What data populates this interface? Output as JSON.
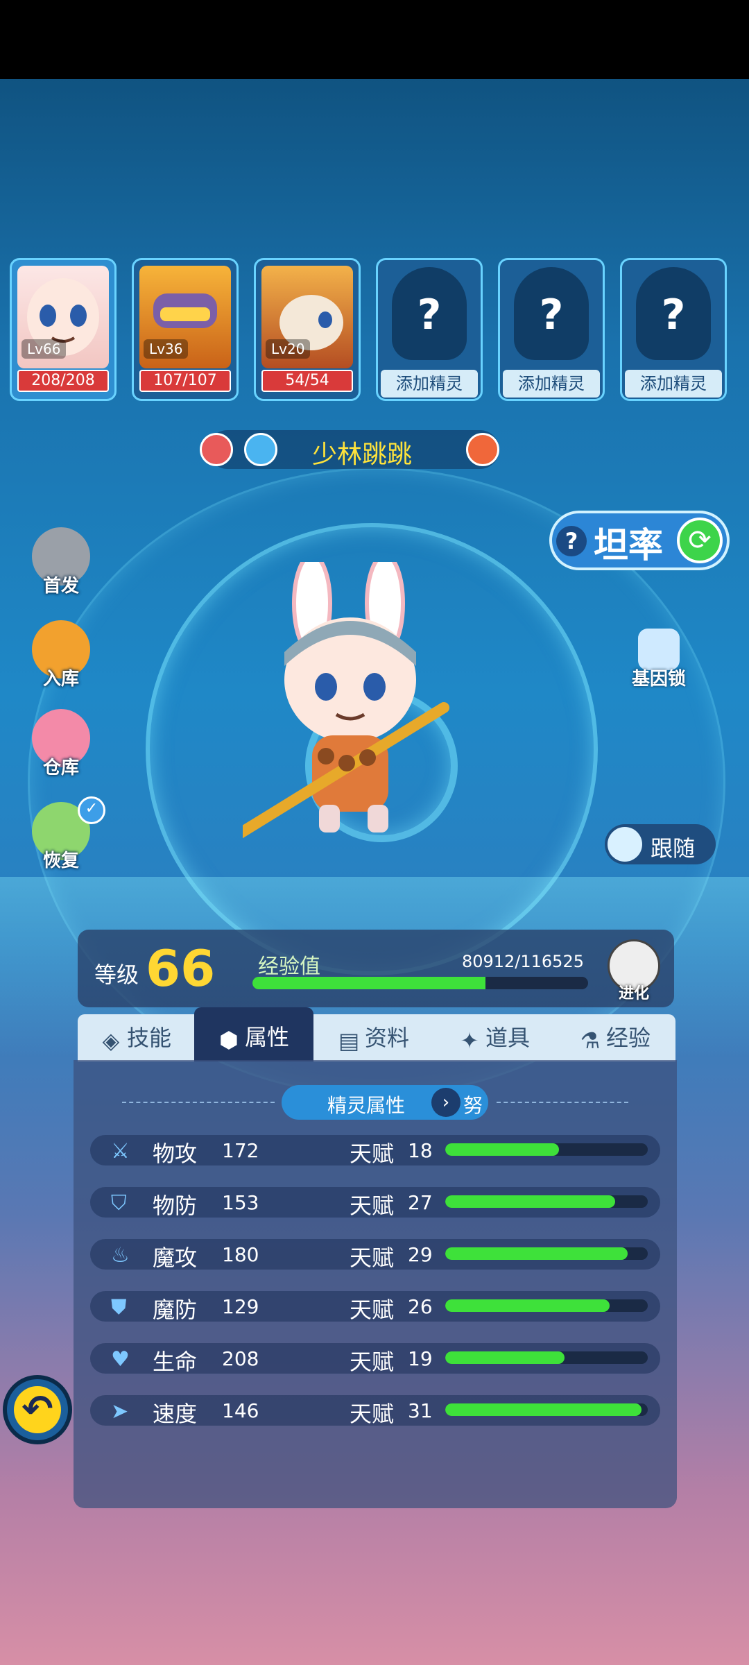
{
  "team": [
    {
      "level": "Lv66",
      "hp": "208/208",
      "active": true
    },
    {
      "level": "Lv36",
      "hp": "107/107"
    },
    {
      "level": "Lv20",
      "hp": "54/54"
    },
    {
      "empty_label": "添加精灵"
    },
    {
      "empty_label": "添加精灵"
    },
    {
      "empty_label": "添加精灵"
    }
  ],
  "unknown_symbol": "?",
  "pet_name": "少林跳跳",
  "side_menu": [
    "首发",
    "入库",
    "仓库",
    "恢复"
  ],
  "trait": {
    "help": "?",
    "label": "坦率"
  },
  "gene_lock": "基因锁",
  "follow": "跟随",
  "level": {
    "label": "等级",
    "value": "66"
  },
  "exp": {
    "label": "经验值",
    "value": "80912/116525",
    "progress": 0.694
  },
  "evolve": "进化",
  "tabs": [
    {
      "label": "技能"
    },
    {
      "label": "属性",
      "selected": true
    },
    {
      "label": "资料"
    },
    {
      "label": "道具"
    },
    {
      "label": "经验"
    }
  ],
  "section": {
    "title": "精灵属性",
    "arrow": "›",
    "next": "努"
  },
  "talent_label": "天赋",
  "stats": [
    {
      "name": "物攻",
      "value": "172",
      "talent": "18",
      "progress": 0.56,
      "icon": "sword-icon"
    },
    {
      "name": "物防",
      "value": "153",
      "talent": "27",
      "progress": 0.84,
      "icon": "shield-icon"
    },
    {
      "name": "魔攻",
      "value": "180",
      "talent": "29",
      "progress": 0.9,
      "icon": "flame-icon"
    },
    {
      "name": "魔防",
      "value": "129",
      "talent": "26",
      "progress": 0.81,
      "icon": "magic-shield-icon"
    },
    {
      "name": "生命",
      "value": "208",
      "talent": "19",
      "progress": 0.59,
      "icon": "heart-plus-icon"
    },
    {
      "name": "速度",
      "value": "146",
      "talent": "31",
      "progress": 0.97,
      "icon": "boot-icon"
    }
  ],
  "colors": {
    "hp": "#d93a3a",
    "exp": "#3ee13a",
    "level": "#ffd733",
    "name": "#ffe33b"
  }
}
